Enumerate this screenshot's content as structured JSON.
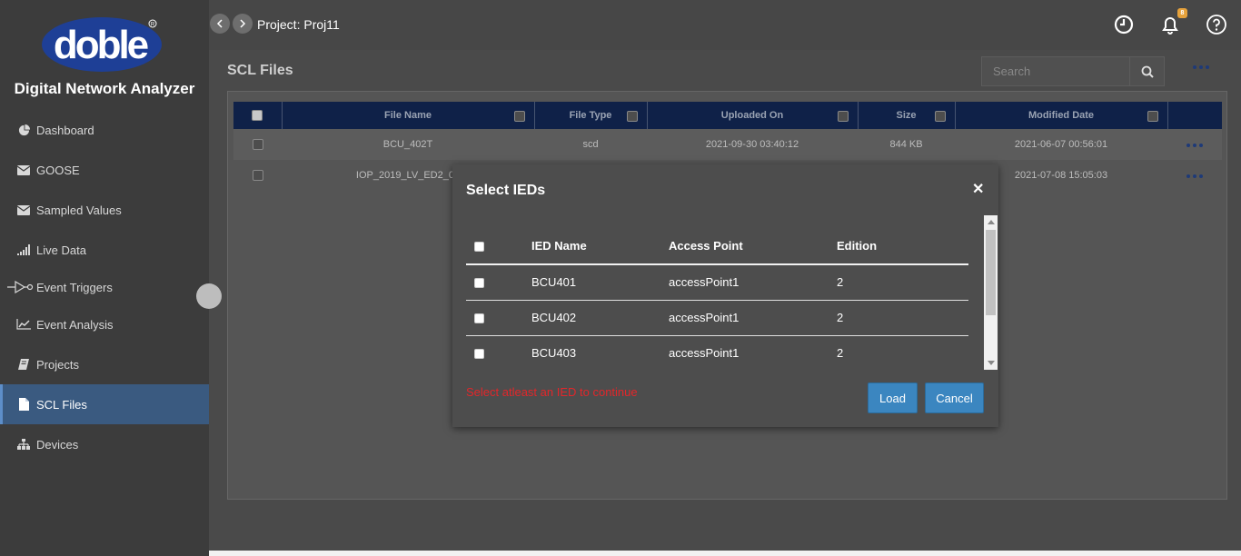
{
  "sidebar": {
    "logo_text": "doble",
    "app_title": "Digital Network Analyzer",
    "items": [
      {
        "label": "Dashboard",
        "icon": "pie-chart-icon"
      },
      {
        "label": "GOOSE",
        "icon": "envelope-icon"
      },
      {
        "label": "Sampled Values",
        "icon": "envelope-icon"
      },
      {
        "label": "Live Data",
        "icon": "signal-bars-icon"
      },
      {
        "label": "Event Triggers",
        "icon": "trigger-icon"
      },
      {
        "label": "Event Analysis",
        "icon": "line-chart-icon"
      },
      {
        "label": "Projects",
        "icon": "book-icon"
      },
      {
        "label": "SCL Files",
        "icon": "file-icon",
        "active": true
      },
      {
        "label": "Devices",
        "icon": "sitemap-icon"
      }
    ]
  },
  "header": {
    "project_label": "Project: Proj11",
    "notification_count": "8"
  },
  "main": {
    "title": "SCL Files",
    "search_placeholder": "Search",
    "columns": [
      "File Name",
      "File Type",
      "Uploaded On",
      "Size",
      "Modified Date"
    ],
    "rows": [
      {
        "file_name": "BCU_402T",
        "file_type": "scd",
        "uploaded_on": "2021-09-30 03:40:12",
        "size": "844 KB",
        "modified": "2021-06-07 00:56:01"
      },
      {
        "file_name": "IOP_2019_LV_ED2_0_",
        "file_type": "",
        "uploaded_on": "",
        "size": "",
        "modified": "2021-07-08 15:05:03"
      }
    ]
  },
  "dialog": {
    "title": "Select IEDs",
    "columns": [
      "IED Name",
      "Access Point",
      "Edition"
    ],
    "rows": [
      {
        "name": "BCU401",
        "access_point": "accessPoint1",
        "edition": "2"
      },
      {
        "name": "BCU402",
        "access_point": "accessPoint1",
        "edition": "2"
      },
      {
        "name": "BCU403",
        "access_point": "accessPoint1",
        "edition": "2"
      }
    ],
    "error": "Select atleast an IED to continue",
    "load_label": "Load",
    "cancel_label": "Cancel"
  },
  "colors": {
    "sidebar_bg": "#3c3c3c",
    "active_nav": "#3a5a80",
    "table_header": "#0f2148",
    "primary_button": "#3b86c0",
    "error_text": "#e3262a"
  }
}
